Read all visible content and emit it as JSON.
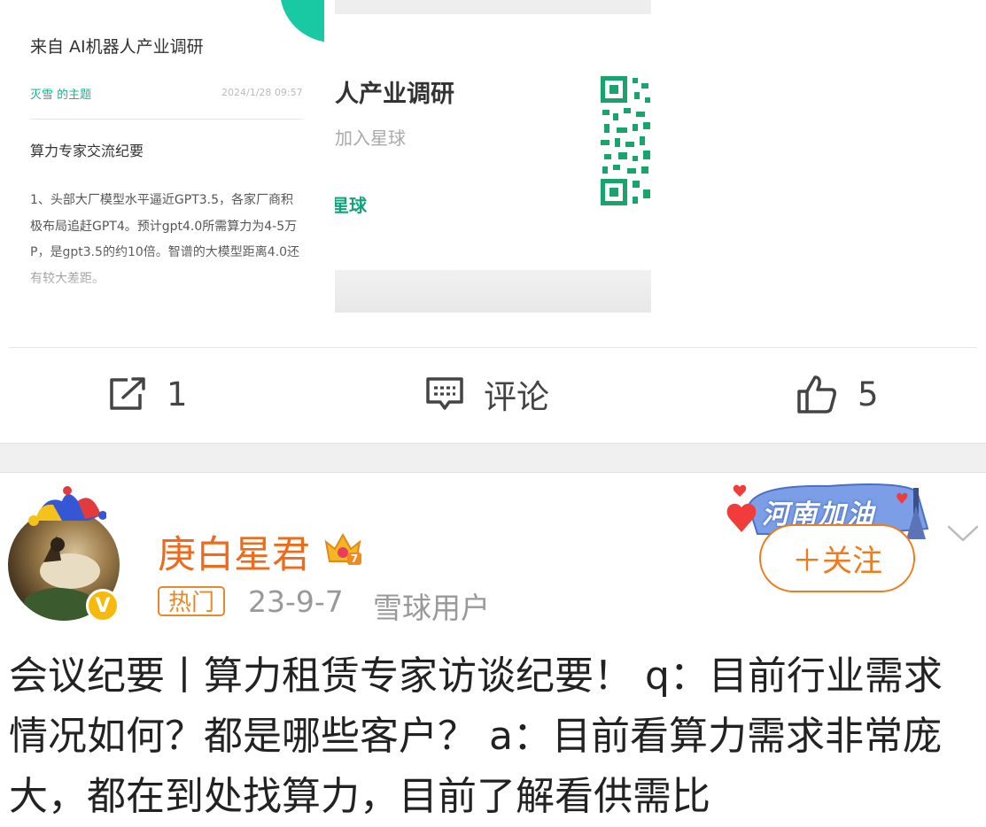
{
  "card_preview": {
    "from_line": "来自 AI机器人产业调研",
    "author_tag": "灭雪 的主题",
    "date": "2024/1/28 09:57",
    "subtitle": "算力专家交流纪要",
    "body": "1、头部大厂模型水平逼近GPT3.5，各家厂商积极布局追赶GPT4。预计gpt4.0所需算力为4-5万P，是gpt3.5的约10倍。智谱的大模型距离4.0还有较大差距。",
    "poster_title": "人产业调研",
    "poster_join": "加入星球",
    "poster_brand": "星球"
  },
  "actions": {
    "share_count": "1",
    "comment_label": "评论",
    "like_count": "5"
  },
  "post": {
    "username": "庚白星君",
    "hot_label": "热门",
    "date": "23-9-7",
    "source": "雪球用户",
    "follow_label": "＋关注",
    "banner_text": "河南加油",
    "verified_mark": "V",
    "crown_badge": "7",
    "text": "会议纪要丨算力租赁专家访谈纪要！  q：目前行业需求情况如何？都是哪些客户？  a：目前看算力需求非常庞大，都在到处找算力，目前了解看供需比"
  },
  "colors": {
    "accent_orange": "#f07a1c",
    "username_orange": "#ee6b1b",
    "teal": "#18c9a4",
    "verified_yellow": "#f6b90c"
  }
}
